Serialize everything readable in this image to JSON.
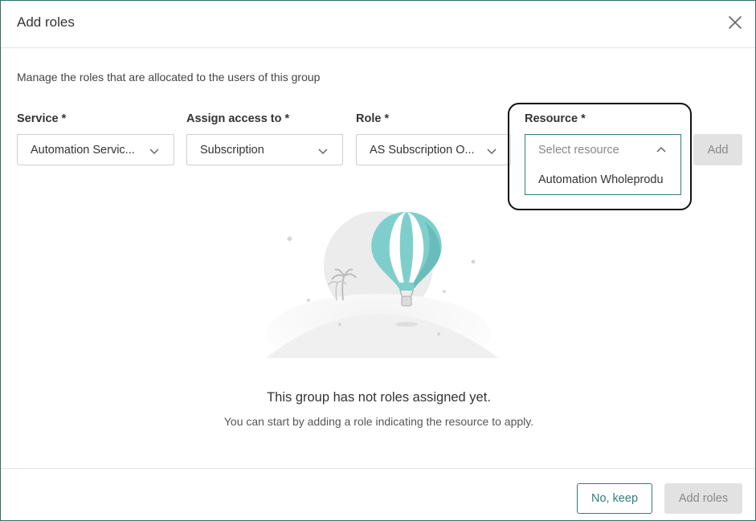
{
  "dialog": {
    "title": "Add roles",
    "subtitle": "Manage the roles that are allocated to the users of this group"
  },
  "fields": {
    "service": {
      "label": "Service *",
      "value": "Automation Servic..."
    },
    "assign": {
      "label": "Assign access to *",
      "value": "Subscription"
    },
    "role": {
      "label": "Role *",
      "value": "AS Subscription O..."
    },
    "resource": {
      "label": "Resource *",
      "placeholder": "Select resource",
      "options": [
        "Automation Wholeprodu"
      ]
    }
  },
  "actions": {
    "add_label": "Add",
    "keep_label": "No, keep",
    "add_roles_label": "Add roles"
  },
  "empty_state": {
    "title": "This group has not roles assigned yet.",
    "description": "You can start by adding a role indicating the resource to apply."
  },
  "icons": {
    "close": "close-icon",
    "chevron_down": "chevron-down-icon",
    "chevron_up": "chevron-up-icon",
    "illustration": "hot-air-balloon-illustration"
  },
  "colors": {
    "accent": "#2f7f7a",
    "balloon": "#7ecfcc",
    "disabled_bg": "#e2e2e2"
  }
}
